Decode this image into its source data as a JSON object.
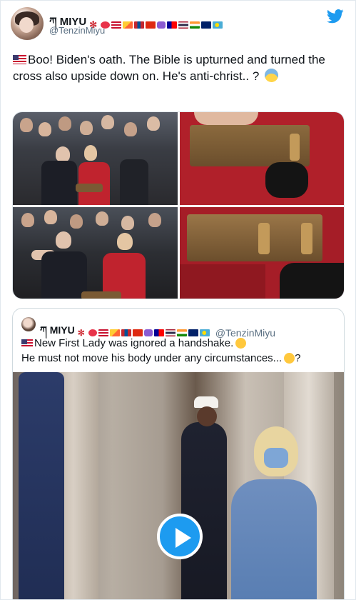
{
  "header": {
    "display_name": "ཀ MIYU",
    "handle": "@TenzinMiyu"
  },
  "tweet": {
    "text": "Boo! Biden's oath. The Bible is upturned and turned the cross also upside down on. He's anti-christ.. ?"
  },
  "quoted_tweet": {
    "display_name": "ཀ MIYU",
    "handle": "@TenzinMiyu",
    "line1": "New First Lady was ignored a handshake.",
    "line2": "He must not move his body under any circumstances...",
    "line2_suffix": "?"
  },
  "icons": {
    "brand": "twitter-bird-icon",
    "media_action": "play-icon"
  },
  "colors": {
    "brand": "#1d9bf0",
    "handle": "#5b7083",
    "text": "#0f1419"
  }
}
